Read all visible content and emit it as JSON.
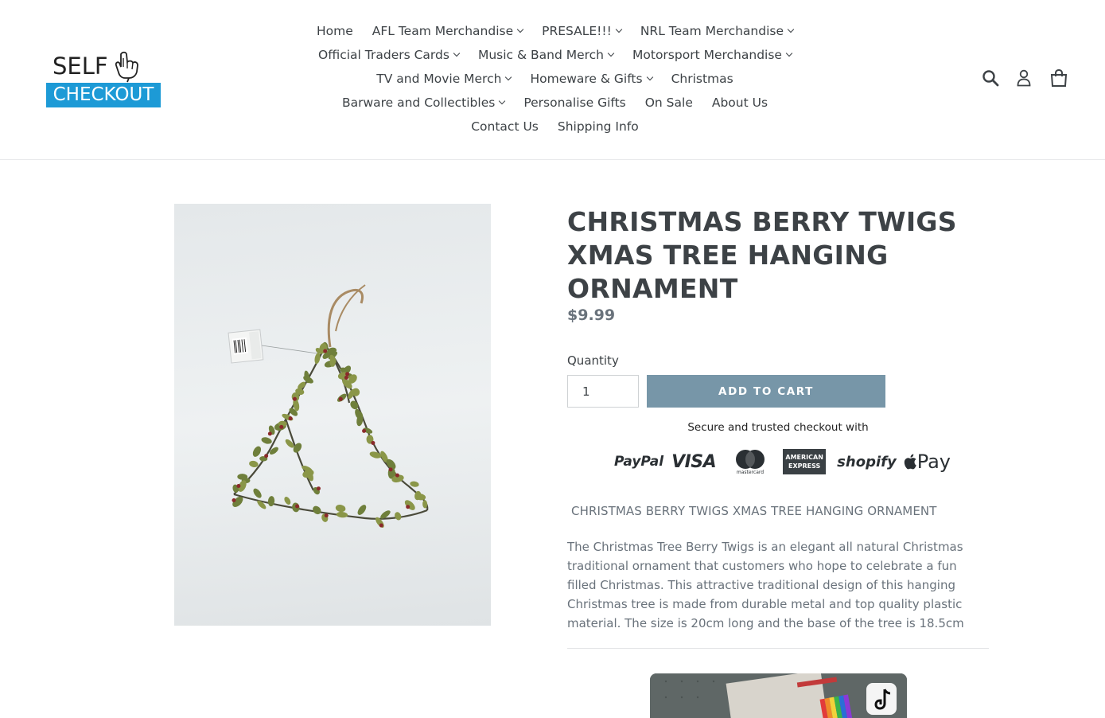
{
  "brand": {
    "logo_top": "SELF",
    "logo_bottom": "CHECKOUT",
    "accent": "#1d9ad6"
  },
  "nav": {
    "rows": [
      [
        {
          "label": "Home",
          "dropdown": false
        },
        {
          "label": "AFL Team Merchandise",
          "dropdown": true
        },
        {
          "label": "PRESALE!!!",
          "dropdown": true
        },
        {
          "label": "NRL Team Merchandise",
          "dropdown": true
        }
      ],
      [
        {
          "label": "Official Traders Cards",
          "dropdown": true
        },
        {
          "label": "Music & Band Merch",
          "dropdown": true
        },
        {
          "label": "Motorsport Merchandise",
          "dropdown": true
        }
      ],
      [
        {
          "label": "TV and Movie Merch",
          "dropdown": true
        },
        {
          "label": "Homeware & Gifts",
          "dropdown": true
        },
        {
          "label": "Christmas",
          "dropdown": false
        }
      ],
      [
        {
          "label": "Barware and Collectibles",
          "dropdown": true
        },
        {
          "label": "Personalise Gifts",
          "dropdown": false
        },
        {
          "label": "On Sale",
          "dropdown": false
        },
        {
          "label": "About Us",
          "dropdown": false
        }
      ],
      [
        {
          "label": "Contact Us",
          "dropdown": false
        },
        {
          "label": "Shipping Info",
          "dropdown": false
        }
      ]
    ]
  },
  "header_icons": [
    "search-icon",
    "account-icon",
    "cart-icon"
  ],
  "product": {
    "title": "CHRISTMAS BERRY TWIGS XMAS TREE HANGING ORNAMENT",
    "price": "$9.99",
    "quantity_label": "Quantity",
    "quantity_value": "1",
    "add_to_cart": "ADD TO CART",
    "secure_text": "Secure and trusted checkout with",
    "payment_methods": {
      "paypal": "PayPal",
      "visa": "VISA",
      "mastercard": "mastercard",
      "amex_line1": "AMERICAN",
      "amex_line2": "EXPRESS",
      "shopify": "shopify",
      "applepay": "Pay"
    },
    "subtitle": "CHRISTMAS BERRY TWIGS XMAS TREE HANGING ORNAMENT",
    "description": "The Christmas Tree Berry Twigs is an elegant all natural Christmas traditional ornament that customers who hope to celebrate a fun filled Christmas. This attractive traditional design of this hanging Christmas tree is made from durable metal and top quality plastic material. The size is 20cm long and the base of the tree is 18.5cm",
    "button_color": "#7796a8"
  }
}
